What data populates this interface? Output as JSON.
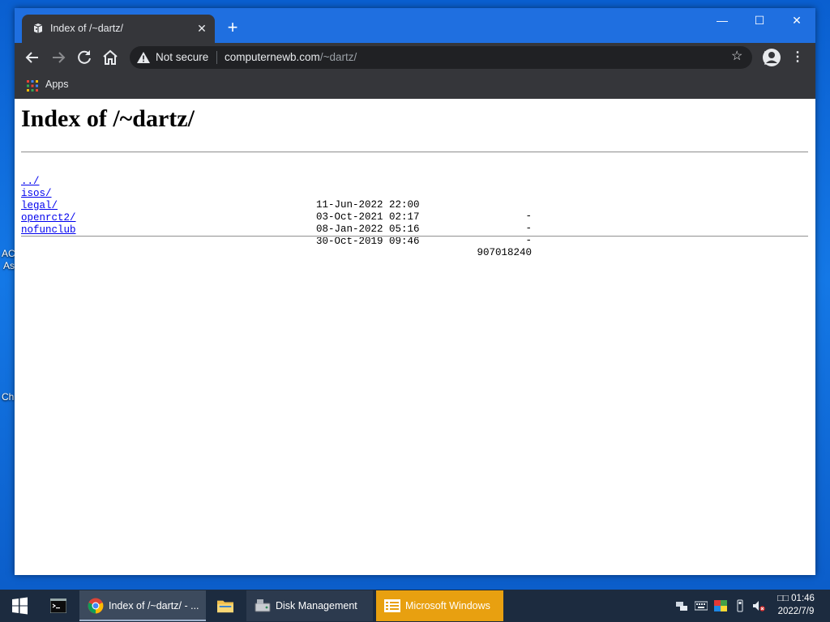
{
  "desktop": {
    "frag1": "AC",
    "frag2": "As",
    "frag3": "Ch"
  },
  "browser": {
    "tab_title": "Index of /~dartz/",
    "omnibox": {
      "security_label": "Not secure",
      "url_host": "computernewb.com",
      "url_path": "/~dartz/"
    },
    "bookmarks": {
      "apps_label": "Apps"
    }
  },
  "page": {
    "heading": "Index of /~dartz/",
    "entries": [
      {
        "name": "../",
        "date": "",
        "size": ""
      },
      {
        "name": "isos/",
        "date": "11-Jun-2022 22:00",
        "size": "-"
      },
      {
        "name": "legal/",
        "date": "03-Oct-2021 02:17",
        "size": "-"
      },
      {
        "name": "openrct2/",
        "date": "08-Jan-2022 05:16",
        "size": "-"
      },
      {
        "name": "nofunclub",
        "date": "30-Oct-2019 09:46",
        "size": "907018240"
      }
    ]
  },
  "taskbar": {
    "items": [
      {
        "label": ""
      },
      {
        "label": "Index of /~dartz/ - ..."
      },
      {
        "label": ""
      },
      {
        "label": "Disk Management"
      },
      {
        "label": "Microsoft Windows"
      }
    ],
    "clock": {
      "time": "□□ 01:46",
      "date": "2022/7/9"
    }
  },
  "colors": {
    "taskbar_bg": "#1c2b3f",
    "highlight_item": "#e8a010",
    "link": "#0000ee",
    "chrome_dark": "#35363a"
  }
}
